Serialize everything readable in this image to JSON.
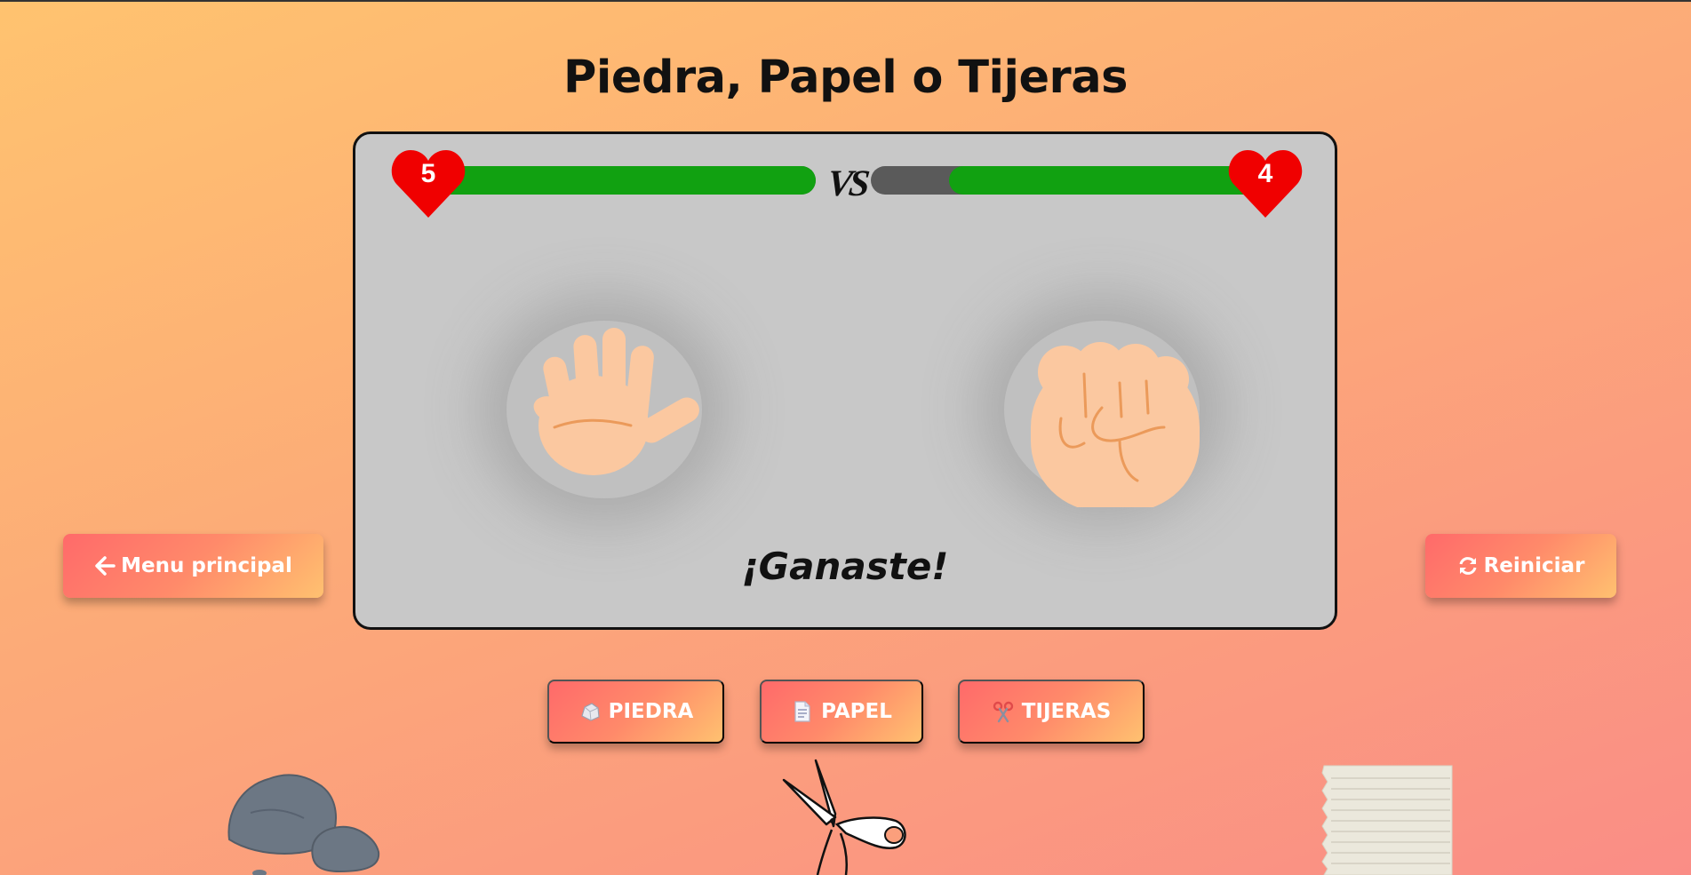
{
  "title": "Piedra, Papel o Tijeras",
  "player": {
    "lives": "5",
    "health_fraction": 1.0,
    "hand": "paper-hand"
  },
  "opponent": {
    "lives": "4",
    "health_fraction": 0.8,
    "hand": "rock-fist"
  },
  "vs_label": "VS",
  "result_text": "¡Ganaste!",
  "buttons": {
    "menu": "Menu principal",
    "restart": "Reiniciar",
    "rock": "PIEDRA",
    "paper": "PAPEL",
    "scissors": "TIJERAS"
  },
  "colors": {
    "health": "#11a111",
    "health_empty": "#5a5a5a",
    "heart": "#f00000",
    "arena": "#c8c8c8"
  },
  "icons": {
    "menu": "arrow-left-icon",
    "restart": "refresh-icon",
    "rock": "rock-icon",
    "paper": "document-icon",
    "scissors": "scissors-icon"
  }
}
